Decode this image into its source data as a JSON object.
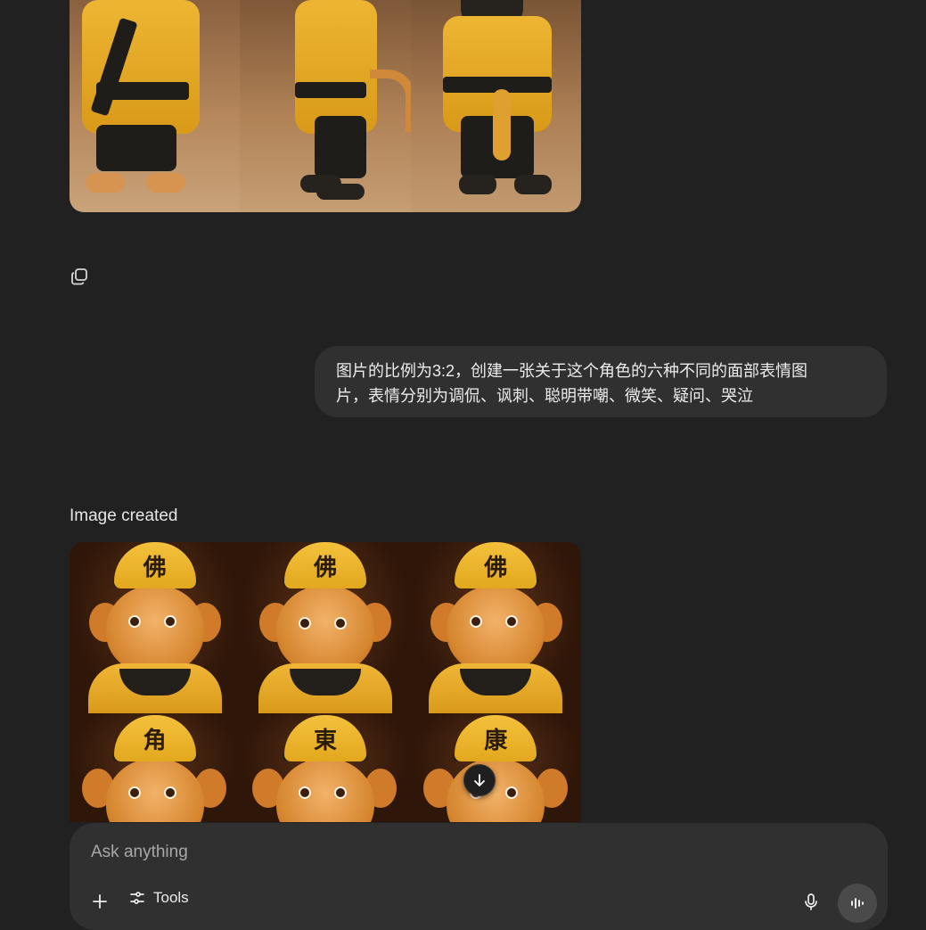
{
  "user_message": {
    "line1": "图片的比例为3:2，创建一张关于这个角色的六种不同的面部表情图",
    "line2": "片，表情分别为调侃、讽刺、聪明带嘲、微笑、疑问、哭泣"
  },
  "image_label": "Image created",
  "cap_glyphs": [
    "佛",
    "佛",
    "佛",
    "角",
    "東",
    "康"
  ],
  "composer": {
    "placeholder": "Ask anything",
    "tools_label": "Tools"
  },
  "icons": {
    "copy": "copy-icon",
    "scroll_down": "arrow-down-icon",
    "plus": "plus-icon",
    "tools": "tools-sliders-icon",
    "mic": "mic-icon",
    "voice": "voice-wave-icon"
  }
}
